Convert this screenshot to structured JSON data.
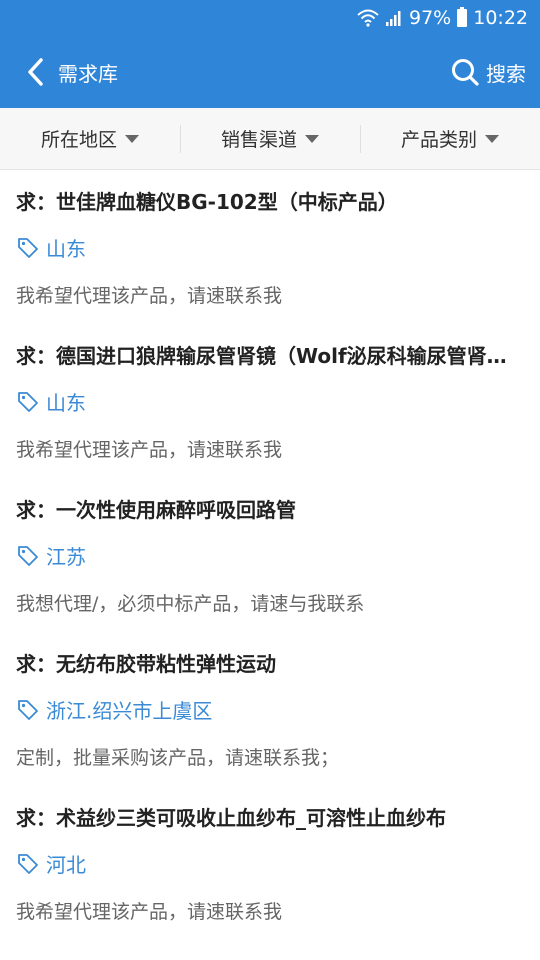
{
  "status_bar": {
    "battery": "97%",
    "time": "10:22"
  },
  "app_bar": {
    "title": "需求库",
    "search_label": "搜索"
  },
  "filters": [
    {
      "label": "所在地区"
    },
    {
      "label": "销售渠道"
    },
    {
      "label": "产品类别"
    }
  ],
  "items": [
    {
      "title": "求：世佳牌血糖仪BG-102型（中标产品）",
      "region": "山东",
      "desc": "我希望代理该产品，请速联系我"
    },
    {
      "title": "求：德国进口狼牌输尿管肾镜（Wolf泌尿科输尿管肾镜）",
      "region": "山东",
      "desc": "我希望代理该产品，请速联系我"
    },
    {
      "title": "求：一次性使用麻醉呼吸回路管",
      "region": "江苏",
      "desc": "我想代理/，必须中标产品，请速与我联系"
    },
    {
      "title": "求：无纺布胶带粘性弹性运动",
      "region": "浙江.绍兴市上虞区",
      "desc": "定制，批量采购该产品，请速联系我；"
    },
    {
      "title": "求：术益纱三类可吸收止血纱布_可溶性止血纱布",
      "region": "河北",
      "desc": "我希望代理该产品，请速联系我"
    }
  ],
  "colors": {
    "primary": "#2f86d8",
    "link": "#3a8ad6"
  }
}
